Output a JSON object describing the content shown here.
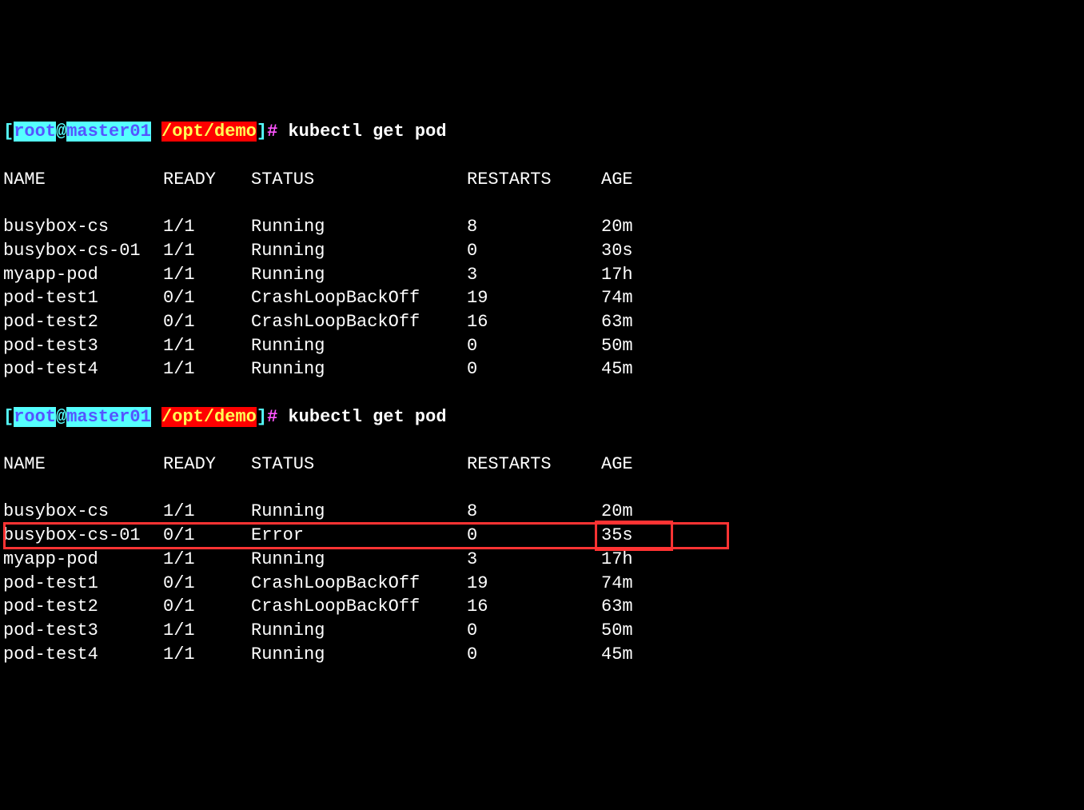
{
  "prompt": {
    "open_bracket": "[",
    "user": "root",
    "at": "@",
    "host": "master01",
    "space": " ",
    "path": "/opt/demo",
    "close_bracket": "]",
    "hash": "#",
    "command": " kubectl get pod"
  },
  "headers": {
    "name": "NAME",
    "ready": "READY",
    "status": "STATUS",
    "restarts": "RESTARTS",
    "age": "AGE"
  },
  "block1": [
    {
      "name": "busybox-cs",
      "ready": "1/1",
      "status": "Running",
      "restarts": "8",
      "age": "20m"
    },
    {
      "name": "busybox-cs-01",
      "ready": "1/1",
      "status": "Running",
      "restarts": "0",
      "age": "30s"
    },
    {
      "name": "myapp-pod",
      "ready": "1/1",
      "status": "Running",
      "restarts": "3",
      "age": "17h"
    },
    {
      "name": "pod-test1",
      "ready": "0/1",
      "status": "CrashLoopBackOff",
      "restarts": "19",
      "age": "74m"
    },
    {
      "name": "pod-test2",
      "ready": "0/1",
      "status": "CrashLoopBackOff",
      "restarts": "16",
      "age": "63m"
    },
    {
      "name": "pod-test3",
      "ready": "1/1",
      "status": "Running",
      "restarts": "0",
      "age": "50m"
    },
    {
      "name": "pod-test4",
      "ready": "1/1",
      "status": "Running",
      "restarts": "0",
      "age": "45m"
    }
  ],
  "block2": [
    {
      "name": "busybox-cs",
      "ready": "1/1",
      "status": "Running",
      "restarts": "8",
      "age": "20m"
    },
    {
      "name": "busybox-cs-01",
      "ready": "0/1",
      "status": "Error",
      "restarts": "0",
      "age": "35s"
    },
    {
      "name": "myapp-pod",
      "ready": "1/1",
      "status": "Running",
      "restarts": "3",
      "age": "17h"
    },
    {
      "name": "pod-test1",
      "ready": "0/1",
      "status": "CrashLoopBackOff",
      "restarts": "19",
      "age": "74m"
    },
    {
      "name": "pod-test2",
      "ready": "0/1",
      "status": "CrashLoopBackOff",
      "restarts": "16",
      "age": "63m"
    },
    {
      "name": "pod-test3",
      "ready": "1/1",
      "status": "Running",
      "restarts": "0",
      "age": "50m"
    },
    {
      "name": "pod-test4",
      "ready": "1/1",
      "status": "Running",
      "restarts": "0",
      "age": "45m"
    }
  ]
}
